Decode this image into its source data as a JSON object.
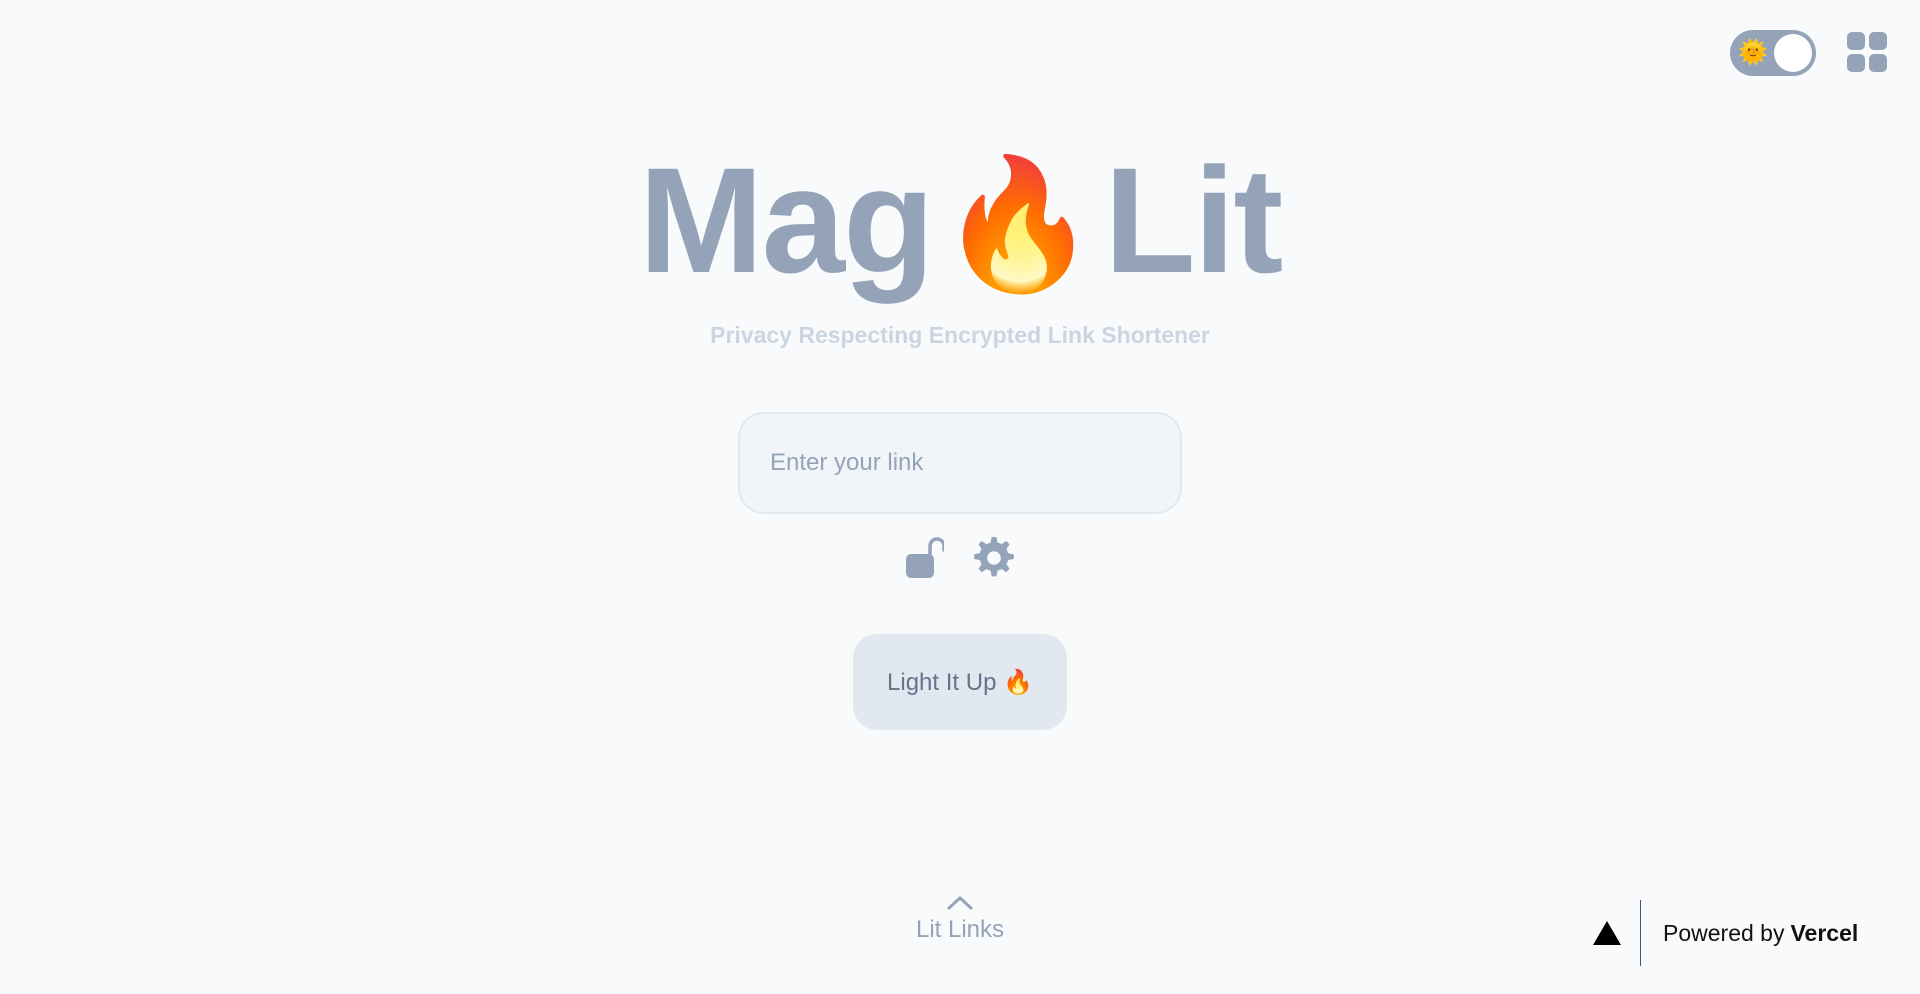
{
  "header": {
    "theme_toggle_emoji": "🌞",
    "theme_mode": "light"
  },
  "logo": {
    "part1": "Mag",
    "fire": "🔥",
    "part2": "Lit"
  },
  "tagline": "Privacy Respecting Encrypted Link Shortener",
  "link_input": {
    "placeholder": "Enter your link",
    "value": ""
  },
  "actions": {
    "lock_icon": "unlocked-padlock-icon",
    "settings_icon": "gear-icon"
  },
  "submit_button": {
    "label": "Light It Up 🔥"
  },
  "footer": {
    "lit_links_label": "Lit Links",
    "powered_by_prefix": "Powered by",
    "powered_by_brand": "Vercel"
  },
  "colors": {
    "background": "#f8fafc",
    "accent_gray": "#94a3b8",
    "input_bg": "#f1f5f9",
    "button_bg": "#e2e8f0"
  }
}
